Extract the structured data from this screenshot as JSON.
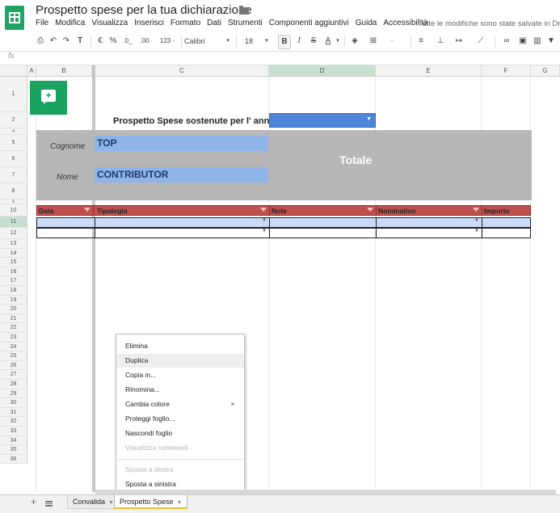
{
  "header": {
    "title": "Prospetto spese per la tua dichiarazione",
    "menu": [
      "File",
      "Modifica",
      "Visualizza",
      "Inserisci",
      "Formato",
      "Dati",
      "Strumenti",
      "Componenti aggiuntivi",
      "Guida",
      "Accessibilità"
    ],
    "save_status": "Tutte le modifiche sono state salvate in Drive"
  },
  "toolbar": {
    "currency": "€",
    "percent": "%",
    "decimal_less": ".0_",
    "decimal_more": ".00",
    "number_format": "123 -",
    "font": "Calibri",
    "font_size": "18",
    "bold": "B",
    "italic": "I",
    "strike": "S",
    "text_color": "A"
  },
  "formula_bar": {
    "fx": "fx"
  },
  "columns": [
    "A",
    "B",
    "C",
    "D",
    "E",
    "F",
    "G"
  ],
  "rows": [
    "1",
    "2",
    "4",
    "5",
    "6",
    "7",
    "8",
    "9",
    "10",
    "11",
    "12",
    "13",
    "14",
    "15",
    "16",
    "17",
    "18",
    "19",
    "20",
    "21",
    "22",
    "23",
    "24",
    "25",
    "26",
    "27",
    "28",
    "29",
    "30",
    "31",
    "32",
    "33",
    "34",
    "35",
    "36"
  ],
  "sheet": {
    "year_label": "Prospetto Spese sostenute per l' anno",
    "cognome_label": "Cognome",
    "cognome_value": "TOP",
    "nome_label": "Nome",
    "nome_value": "CONTRIBUTOR",
    "totale": "Totale",
    "table_headers": [
      "Data",
      "Tipologia",
      "Note",
      "Nominativo",
      "Importo"
    ]
  },
  "context_menu": {
    "items": [
      {
        "label": "Elimina",
        "disabled": false
      },
      {
        "label": "Duplica",
        "disabled": false,
        "highlighted": true
      },
      {
        "label": "Copia in...",
        "disabled": false
      },
      {
        "label": "Rinomina...",
        "disabled": false
      },
      {
        "label": "Cambia colore",
        "disabled": false,
        "submenu": true
      },
      {
        "label": "Proteggi foglio...",
        "disabled": false
      },
      {
        "label": "Nascondi foglio",
        "disabled": false
      },
      {
        "label": "Visualizza commenti",
        "disabled": true
      },
      {
        "label": "Sposta a destra",
        "disabled": true
      },
      {
        "label": "Sposta a sinistra",
        "disabled": false
      }
    ]
  },
  "sheet_tabs": [
    {
      "label": "Convalida"
    },
    {
      "label": "Prospetto Spese",
      "active": true
    }
  ],
  "colors": {
    "brand_green": "#1fa463",
    "header_red": "#c0504d",
    "name_blue": "#8fb4e8",
    "select_blue": "#4f86d9",
    "panel_gray": "#b7b7b7"
  }
}
